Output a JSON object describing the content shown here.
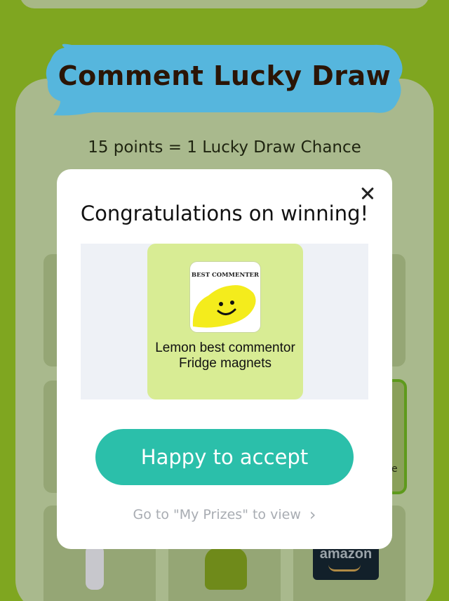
{
  "page": {
    "title": "Comment Lucky Draw",
    "subtitle": "15 points = 1 Lucky Draw Chance",
    "amazon_logo_text": "amazon"
  },
  "modal": {
    "title": "Congratulations on winning!",
    "prize": {
      "image_label": "BEST COMMENTER",
      "name": "Lemon best commentor Fridge magnets"
    },
    "accept_label": "Happy to accept",
    "view_link_label": "Go to \"My Prizes\" to view",
    "close_icon": "close-icon",
    "chevron_icon": "chevron-right-icon"
  },
  "colors": {
    "background": "#7fa620",
    "banner": "#56b6dd",
    "accent": "#2bbfaa",
    "prize_card": "#d8ec94"
  }
}
